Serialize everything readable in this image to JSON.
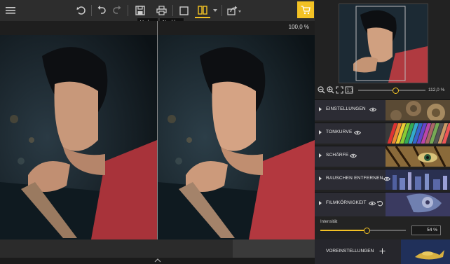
{
  "toolbar": {
    "tooltip_before": "Vorher",
    "tooltip_after": "Nachher"
  },
  "viewer": {
    "zoom": "100,0 %"
  },
  "navigator": {
    "zoom": "112,0 %",
    "zoom_level": 0.55
  },
  "panel": {
    "sections": [
      {
        "label": "EINSTELLUNGEN"
      },
      {
        "label": "TONKURVE"
      },
      {
        "label": "SCHÄRFE"
      },
      {
        "label": "RAUSCHEN ENTFERNEN"
      },
      {
        "label": "FILMKÖRNIGKEIT"
      }
    ],
    "grain": {
      "label": "Intensität",
      "value": "54 %",
      "level": 0.54
    },
    "presets": {
      "label": "VOREINSTELLUNGEN"
    }
  },
  "colors": {
    "accent": "#f3c224",
    "panel": "#2c2c34"
  }
}
